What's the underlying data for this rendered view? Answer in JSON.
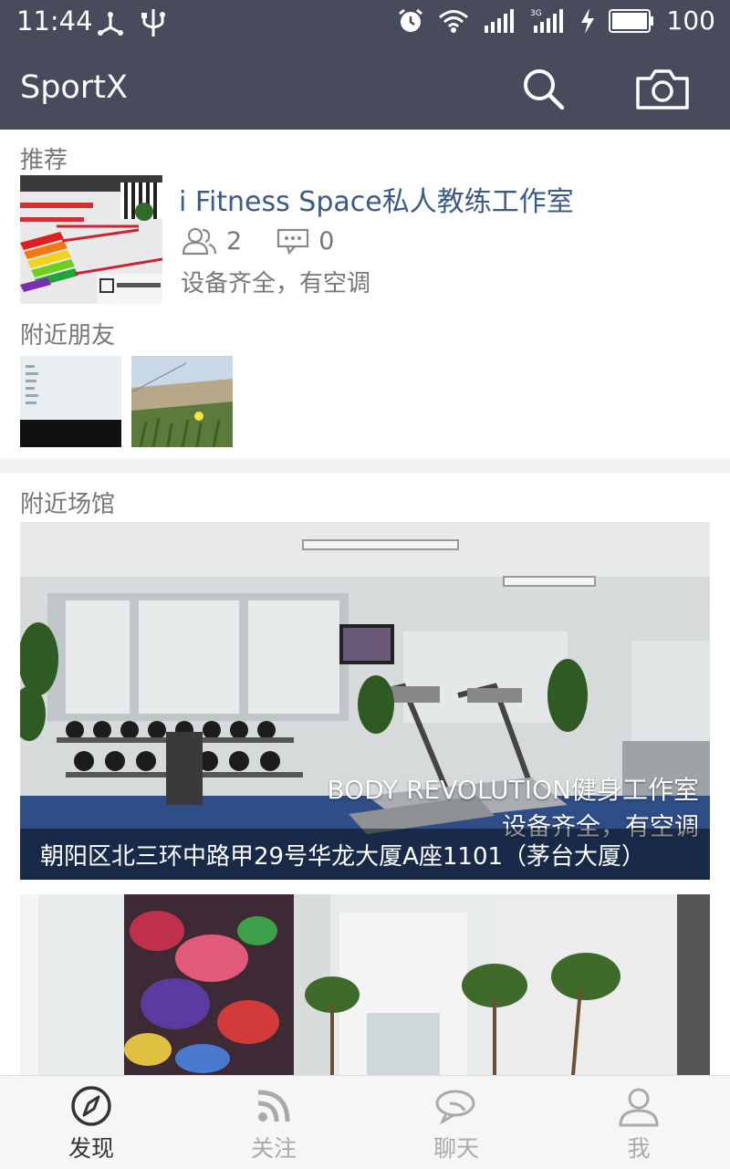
{
  "status_bar": {
    "time": "11:44",
    "battery": "100",
    "icons": [
      "usb-icon",
      "alarm-icon",
      "wifi-icon",
      "signal-icon",
      "3g-signal-icon",
      "charging-icon",
      "battery-icon"
    ]
  },
  "app_bar": {
    "title": "SportX",
    "actions": [
      "search-icon",
      "camera-icon"
    ]
  },
  "recommended": {
    "section_label": "推荐",
    "title": "i Fitness Space私人教练工作室",
    "members": "2",
    "comments": "0",
    "description": "设备齐全，有空调"
  },
  "nearby_friends": {
    "section_label": "附近朋友"
  },
  "nearby_venues": {
    "section_label": "附近场馆",
    "items": [
      {
        "name": "BODY REVOLUTION健身工作室",
        "description": "设备齐全，有空调",
        "address": "朝阳区北三环中路甲29号华龙大厦A座1101（茅台大厦）"
      }
    ]
  },
  "bottom_nav": {
    "items": [
      {
        "label": "发现",
        "icon": "compass-icon",
        "active": true
      },
      {
        "label": "关注",
        "icon": "rss-icon",
        "active": false
      },
      {
        "label": "聊天",
        "icon": "chat-icon",
        "active": false
      },
      {
        "label": "我",
        "icon": "person-icon",
        "active": false
      }
    ]
  },
  "colors": {
    "header": "#474b5b",
    "link": "#3c5a86",
    "active_nav": "#333333",
    "inactive_nav": "#aaaaaa"
  }
}
